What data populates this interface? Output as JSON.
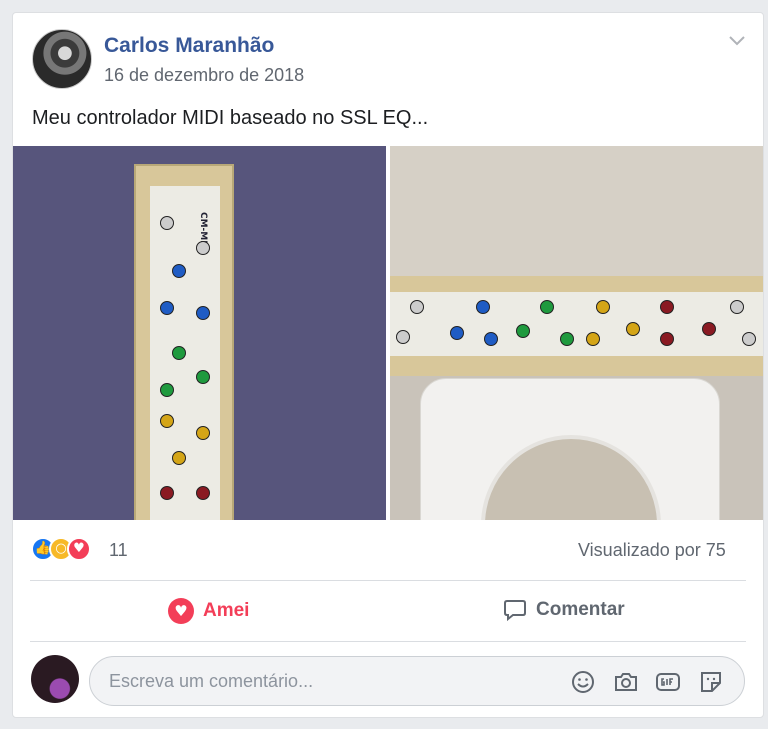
{
  "post": {
    "author": "Carlos Maranhão",
    "date": "16 de dezembro de 2018",
    "text": "Meu controlador MIDI baseado no SSL EQ...",
    "photo_label": "CM-MIDI"
  },
  "reactions": {
    "icons": [
      "like-icon",
      "wow-icon",
      "love-icon"
    ],
    "count": "11",
    "views": "Visualizado por 75"
  },
  "actions": {
    "love_label": "Amei",
    "comment_label": "Comentar"
  },
  "composer": {
    "placeholder": "Escreva um comentário...",
    "icons": [
      "emoji-icon",
      "camera-icon",
      "gif-icon",
      "sticker-icon"
    ]
  },
  "colors": {
    "author": "#385898",
    "love": "#f33e58",
    "like": "#1877f2",
    "wow": "#f7b928"
  }
}
